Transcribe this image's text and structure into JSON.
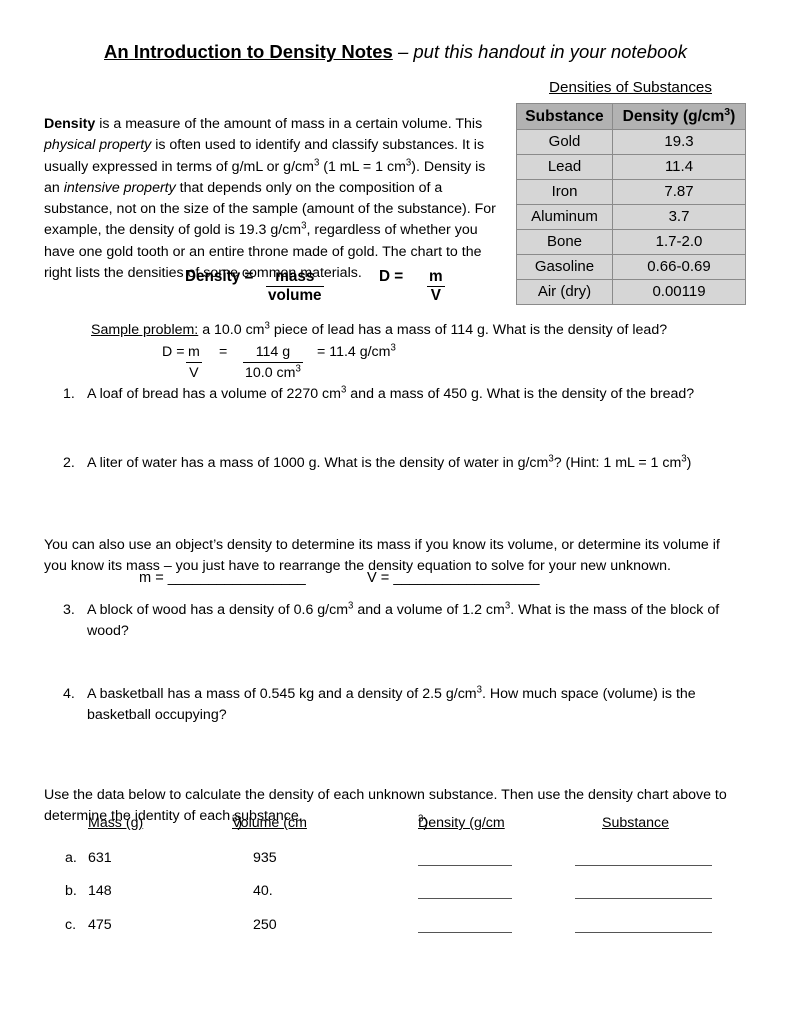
{
  "title": {
    "main": "An Introduction to Density Notes",
    "separator": " – ",
    "subtitle": "put this handout in your notebook"
  },
  "intro": {
    "term": "Density",
    "line_rest_1": " is a measure of the amount of mass in a certain volume.  This ",
    "italic_1": "physical property",
    "line_rest_2": " is often used to identify and classify substances.  It is usually expressed in terms of g/mL or g/cm",
    "sup_1": "3",
    "line_rest_3": " (1 mL = 1 cm",
    "sup_2": "3",
    "line_rest_4": ").  Density is an ",
    "italic_2": "intensive property",
    "line_rest_5": " that depends only on the composition of a substance, not on the size of the sample (amount of the substance).  For example, the density of gold is 19.3 g/cm",
    "sup_3": "3",
    "line_rest_6": ", regardless of whether you have one gold tooth or an entire throne made of gold.  The chart to the right lists the densities of some common materials."
  },
  "density_table": {
    "caption": "Densities of Substances",
    "columns": [
      "Substance",
      "Density (g/cm³)"
    ],
    "column_html": [
      "Substance",
      "Density (g/cm"
    ],
    "column_sup": "3",
    "column_tail": ")",
    "rows": [
      {
        "substance": "Gold",
        "density": "19.3"
      },
      {
        "substance": "Lead",
        "density": "11.4"
      },
      {
        "substance": "Iron",
        "density": "7.87"
      },
      {
        "substance": "Aluminum",
        "density": "3.7"
      },
      {
        "substance": "Bone",
        "density": "1.7-2.0"
      },
      {
        "substance": "Gasoline",
        "density": "0.66-0.69"
      },
      {
        "substance": "Air (dry)",
        "density": "0.00119"
      }
    ],
    "header_bg": "#b2b2b2",
    "cell_bg": "#d6d6d6",
    "border_color": "#8a8a8a"
  },
  "equation": {
    "label": "Density =",
    "numerator": "mass",
    "denominator": "volume",
    "short_label": "D =",
    "short_numerator": "m",
    "short_denominator": "V"
  },
  "sample_problem": {
    "label": "Sample problem:",
    "statement_a": " a 10.0 cm",
    "statement_sup": "3",
    "statement_b": " piece of lead has a mass of 114 g.  What is the density of lead?",
    "work_d": "D =",
    "work_num1": "m",
    "work_den1": "V",
    "work_equals": "=",
    "work_num2": "114 g",
    "work_den2": "10.0 cm³",
    "work_den2_base": "10.0 cm",
    "work_den2_sup": "3",
    "work_result_a": "= 11.4 g/cm",
    "work_result_sup": "3"
  },
  "questions": [
    {
      "number": "1.",
      "text_a": "A loaf of bread has a volume of 2270 cm",
      "sup_1": "3",
      "text_b": " and a mass of 450 g.  What is the density of the bread?",
      "sup_2": "",
      "text_c": ""
    },
    {
      "number": "2.",
      "text_a": "A liter of water has a mass of 1000 g.  What is the density of water in g/cm",
      "sup_1": "3",
      "text_b": "? (Hint: 1 mL = 1 cm",
      "sup_2": "3",
      "text_c": ")"
    },
    {
      "number": "3.",
      "text_a": "A block of wood has a density of 0.6 g/cm",
      "sup_1": "3",
      "text_b": " and a volume of 1.2 cm",
      "sup_2": "3",
      "text_c": ".  What is the mass of the block of wood?"
    },
    {
      "number": "4.",
      "text_a": "A basketball has a mass of 0.545 kg and a density of 2.5 g/cm",
      "sup_1": "3",
      "text_b": ".  How much space (volume) is the basketball occupying?",
      "sup_2": "",
      "text_c": ""
    }
  ],
  "rearrange_paragraph": "You can also use an object’s density to determine its mass if you know its volume, or determine its volume if you know its mass – you just have to rearrange the density equation to solve for your new unknown.",
  "blanks": {
    "mass_label": "m = ",
    "mass_blank": "_________________",
    "volume_label": "V = ",
    "volume_blank": "__________________"
  },
  "bottom_instructions": "Use the data below to calculate the density of each unknown substance.  Then use the density chart above to determine the identity of each substance.",
  "data_table": {
    "headers": [
      "Mass (g)",
      "Volume (cm³)",
      "Density (g/cm³)",
      "Substance"
    ],
    "header_parts": [
      {
        "base": "Mass (g)",
        "sup": "",
        "tail": ""
      },
      {
        "base": "Volume (cm",
        "sup": "3",
        "tail": ")"
      },
      {
        "base": "Density (g/cm",
        "sup": "3",
        "tail": ")"
      },
      {
        "base": "Substance",
        "sup": "",
        "tail": ""
      }
    ],
    "rows": [
      {
        "label": "a.",
        "mass": "631",
        "volume": "935",
        "density": "",
        "substance": ""
      },
      {
        "label": "b.",
        "mass": "148",
        "volume": "40.",
        "density": "",
        "substance": ""
      },
      {
        "label": "c.",
        "mass": "475",
        "volume": "250",
        "density": "",
        "substance": ""
      }
    ]
  }
}
